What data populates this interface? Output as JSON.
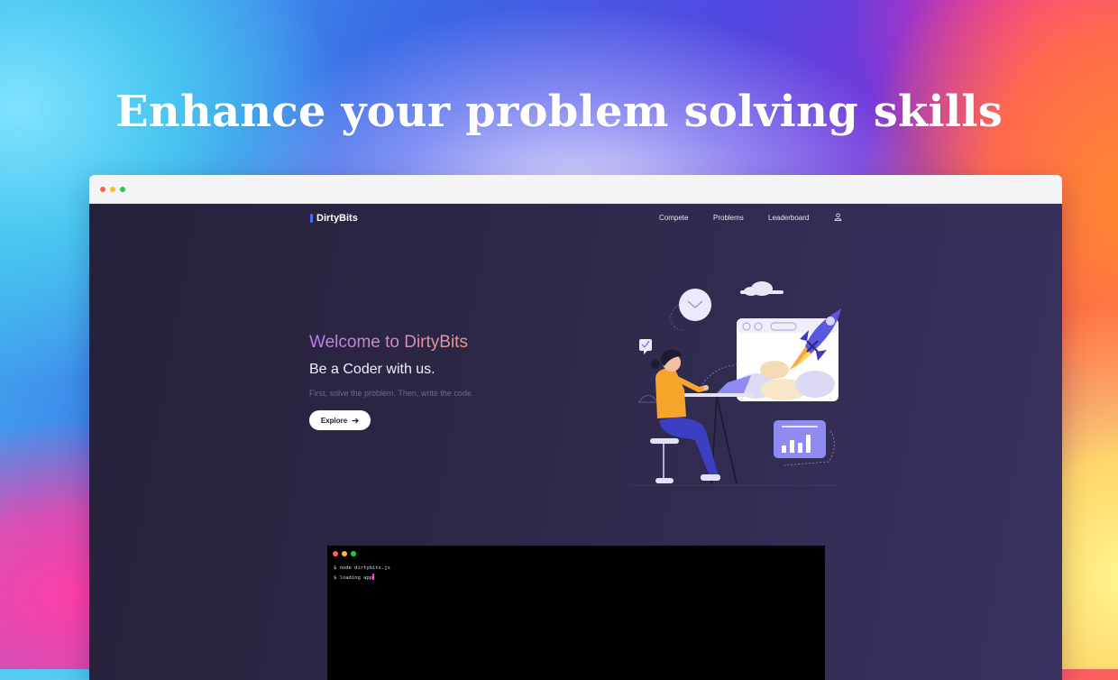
{
  "headline": "Enhance your problem solving skills",
  "colors": {
    "window_dot_red": "#ff5f57",
    "window_dot_yellow": "#febc2e",
    "window_dot_green": "#28c840",
    "brand_accent": "#4a6cf7",
    "hero_title_gradient_start": "#b87cf5",
    "hero_title_gradient_end": "#ec9a8f",
    "page_background": "#2d2747",
    "cursor": "#ff3fd0"
  },
  "site": {
    "logo_text": "DirtyBits",
    "nav": {
      "items": [
        "Compete",
        "Problems",
        "Leaderboard"
      ],
      "user_icon": "user-icon"
    },
    "hero": {
      "title": "Welcome to DirtyBits",
      "subtitle": "Be a Coder with us.",
      "tagline": "First, solve the problem. Then, write the code.",
      "button_label": "Explore",
      "button_icon": "arrow-right-icon"
    },
    "terminal": {
      "line1": "$ node dirtybits.js",
      "line2": "$ loading app"
    }
  }
}
